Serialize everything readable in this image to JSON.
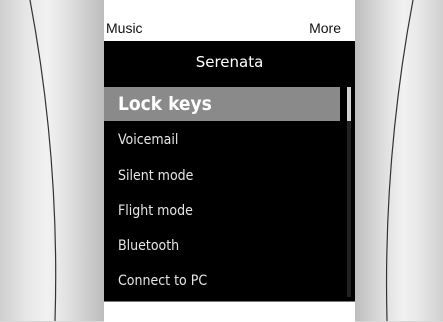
{
  "softkeys": {
    "left": "Music",
    "right": "More"
  },
  "panel": {
    "title": "Serenata"
  },
  "menu": {
    "items": [
      {
        "label": "Lock keys",
        "selected": true
      },
      {
        "label": "Voicemail",
        "selected": false
      },
      {
        "label": "Silent mode",
        "selected": false
      },
      {
        "label": "Flight mode",
        "selected": false
      },
      {
        "label": "Bluetooth",
        "selected": false
      },
      {
        "label": "Connect to PC",
        "selected": false
      }
    ]
  },
  "colors": {
    "selection": "#8a8a8a",
    "screen": "#000000",
    "softkey_bar": "#ffffff"
  }
}
